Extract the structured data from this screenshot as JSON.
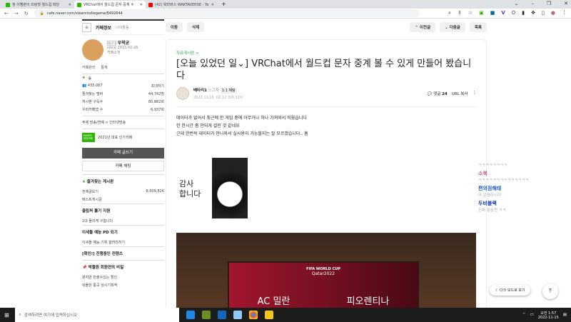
{
  "browser": {
    "tabs": [
      {
        "title": "정 이쌤분이 프랑켓 월드컵 레당",
        "fav": "#2db400"
      },
      {
        "title": "VRChat에서 월드컵 문자 중계 ㅎ",
        "fav": "#2db400"
      },
      {
        "title": "(42) 왁타버스 WAKTAVERSE - Yo",
        "fav": "#ff0000"
      }
    ],
    "new_tab": "+",
    "url": "cafe.naver.com/steamindiegame/8492644"
  },
  "sidebar": {
    "tab_info": "카페정보",
    "tab_activity": "나의활동",
    "manager_badge": "매니저",
    "manager": "우왁굳",
    "since": "since 2015.02.26.",
    "cafe_intro": "카페소개",
    "cafe_manage": "카페관리",
    "stats": "통계",
    "level": "숲",
    "members": "435,087",
    "invite": "초대하기",
    "stats_rows": [
      {
        "label": "즐겨찾는 멤버",
        "value": "44,742명"
      },
      {
        "label": "게시판 구독수",
        "value": "80,882회"
      },
      {
        "label": "우리카페앱 수",
        "value": "6,937회"
      }
    ],
    "topic": "주제 방송/연예 > 인터넷방송",
    "naver_badge": "NAVER 대표카페",
    "award": "2021년 대표 인기카페",
    "write": "카페 글쓰기",
    "chat": "카페 채팅",
    "fav_boards": "즐겨찾는 게시판",
    "all_posts": "전체글보기",
    "all_count": "8,609,826",
    "best": "베스트게시글",
    "sections": [
      {
        "title": "클립퍼 뚫기 지원",
        "items": [
          "1대 돌리게 구합니다"
        ]
      },
      {
        "title": "이세돌 예능 PD 되기",
        "items": [
          "이세돌 예능 기획 갤러리허기"
        ]
      },
      {
        "title": "[확인!] 진행중인 컨텐츠",
        "items": []
      },
      {
        "title": "박물원 회원연의 비밀",
        "items": [
          "왠지만 반출수있는 할인",
          "왁물원 통곡 상시기획적"
        ]
      }
    ]
  },
  "toolbar": {
    "move": "이동",
    "delete": "삭제",
    "prev": "이전글",
    "next": "다음글",
    "list": "목록"
  },
  "article": {
    "board": "자유게시판 >",
    "title": "[오늘 있었던 일⌄] VRChat에서 월드컵 문자 중계 볼 수 있게 만들어 봤습니다",
    "author": "베타리1",
    "rank": "느그자",
    "chat_btn": "1:1 채팅",
    "date": "2022.11.15. 01:12",
    "views": "조회 110",
    "comments_label": "댓글",
    "comments": "24",
    "url_copy": "URL 복사",
    "body": [
      "데이터가 없어서 최근에 한 게임 중에 아무거나 하나 가져와서 띄웠습니다",
      "한 한시간 좀 안되게 걸린 것 같네요",
      "근데 한번씩 데이터가 안나와서 실사용이 가능할지는 잘 모르겠습니다.. 흠"
    ],
    "meme_text": "감사\n합니다",
    "fifa": "FIFA WORLD CUP",
    "qatar": "Qatar2022",
    "team1": "AC 밀란",
    "team2": "피오렌티나"
  },
  "chat": [
    {
      "name": "",
      "msg": "ㅋㅋㅋㅋㅋㅋㅋㅋ",
      "color": "#c33"
    },
    {
      "name": "소북",
      "msg": "ㅋㅋㅋㅋㅋㅋㅋㅋㅋㅋㅋㅋㅋㅋ",
      "color": "#c9508a"
    },
    {
      "name": "편의점해태",
      "msg": "아 운평하시지",
      "color": "#1a5fc9"
    },
    {
      "name": "두비블랙",
      "msg": "진짜 힘숨찐 ㅋㅋ",
      "color": "#0a3aa8"
    }
  ],
  "dark_mode": "다크 모드로 보기",
  "top": "⤒",
  "taskbar": {
    "search": "검색하려면 여기에 입력하십시오",
    "time": "오전 1:57",
    "date": "2022-11-15"
  }
}
